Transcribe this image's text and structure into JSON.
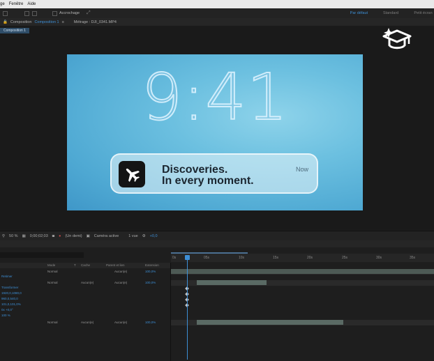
{
  "menubar": {
    "items": [
      "ge",
      "Fenêtre",
      "Aide"
    ]
  },
  "toolbar": {
    "snap_label": "Accrochage",
    "workspaces": [
      "Par défaut",
      "Standard",
      "Petit écran"
    ]
  },
  "comp_tabs": {
    "comp_label": "Composition",
    "comp_name": "Composition 1",
    "footage_label": "Métrage : DJI_0341.MP4",
    "viewer_tab": "Composition 1"
  },
  "canvas": {
    "clock": "9:41",
    "notification": {
      "title": "Discoveries.",
      "subtitle": "In every moment.",
      "time": "Now"
    }
  },
  "viewer_controls": {
    "zoom": "50 %",
    "timecode": "0;00;02;03",
    "resolution": "(Un demi)",
    "camera": "Caméra active",
    "views": "1 vue",
    "exposure": "+0,0"
  },
  "timeline": {
    "columns": {
      "mode": "Mode",
      "trkmat": "T",
      "cache": "Cache",
      "parent": "Parent et lien",
      "duration": "Extension"
    },
    "ruler_ticks": [
      "0s",
      "05s",
      "10s",
      "15s",
      "20s",
      "25s",
      "30s",
      "35s"
    ],
    "layers": [
      {
        "mode": "Normal",
        "parent": "Aucun(e)",
        "duration": "100,0%"
      },
      {
        "mode": "Normal",
        "trkmat": "Aucun(e)",
        "parent": "Aucun(e)",
        "duration": "100,0%"
      },
      {
        "mode": "Normal",
        "trkmat": "Aucun(e)",
        "parent": "Aucun(e)",
        "duration": "100,0%"
      }
    ],
    "props": [
      "Retimer",
      "Transformer",
      "1920,0,1080,0",
      "960,0,540,0",
      "101,0,101,0%",
      "0x +0,0°",
      "100 %"
    ]
  }
}
